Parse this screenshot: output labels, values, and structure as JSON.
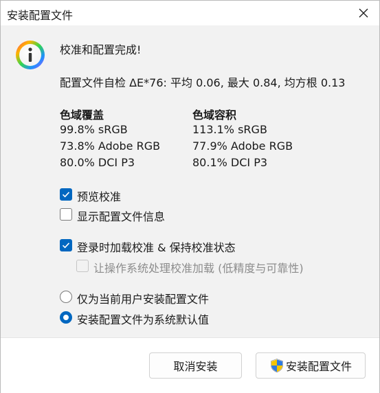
{
  "window": {
    "title": "安装配置文件"
  },
  "main": {
    "headline": "校准和配置完成!",
    "selfcheck": "配置文件自检 ΔE*76: 平均 0.06, 最大 0.84, 均方根 0.13",
    "gamut_coverage": {
      "title": "色域覆盖",
      "rows": [
        "99.8% sRGB",
        "73.8% Adobe RGB",
        "80.0% DCI P3"
      ]
    },
    "gamut_volume": {
      "title": "色域容积",
      "rows": [
        "113.1% sRGB",
        "77.9% Adobe RGB",
        "80.1% DCI P3"
      ]
    }
  },
  "options": {
    "preview_calibration": {
      "label": "预览校准",
      "checked": true
    },
    "show_profile_info": {
      "label": "显示配置文件信息",
      "checked": false
    },
    "load_on_login": {
      "label": "登录时加载校准 & 保持校准状态",
      "checked": true
    },
    "os_loading": {
      "label": "让操作系统处理校准加载 (低精度与可靠性)",
      "checked": false,
      "disabled": true
    },
    "install_current_user": {
      "label": "仅为当前用户安装配置文件",
      "selected": false
    },
    "install_system_default": {
      "label": "安装配置文件为系统默认值",
      "selected": true
    }
  },
  "buttons": {
    "cancel": "取消安装",
    "install": "安装配置文件"
  },
  "colors": {
    "accent": "#0067c0"
  }
}
